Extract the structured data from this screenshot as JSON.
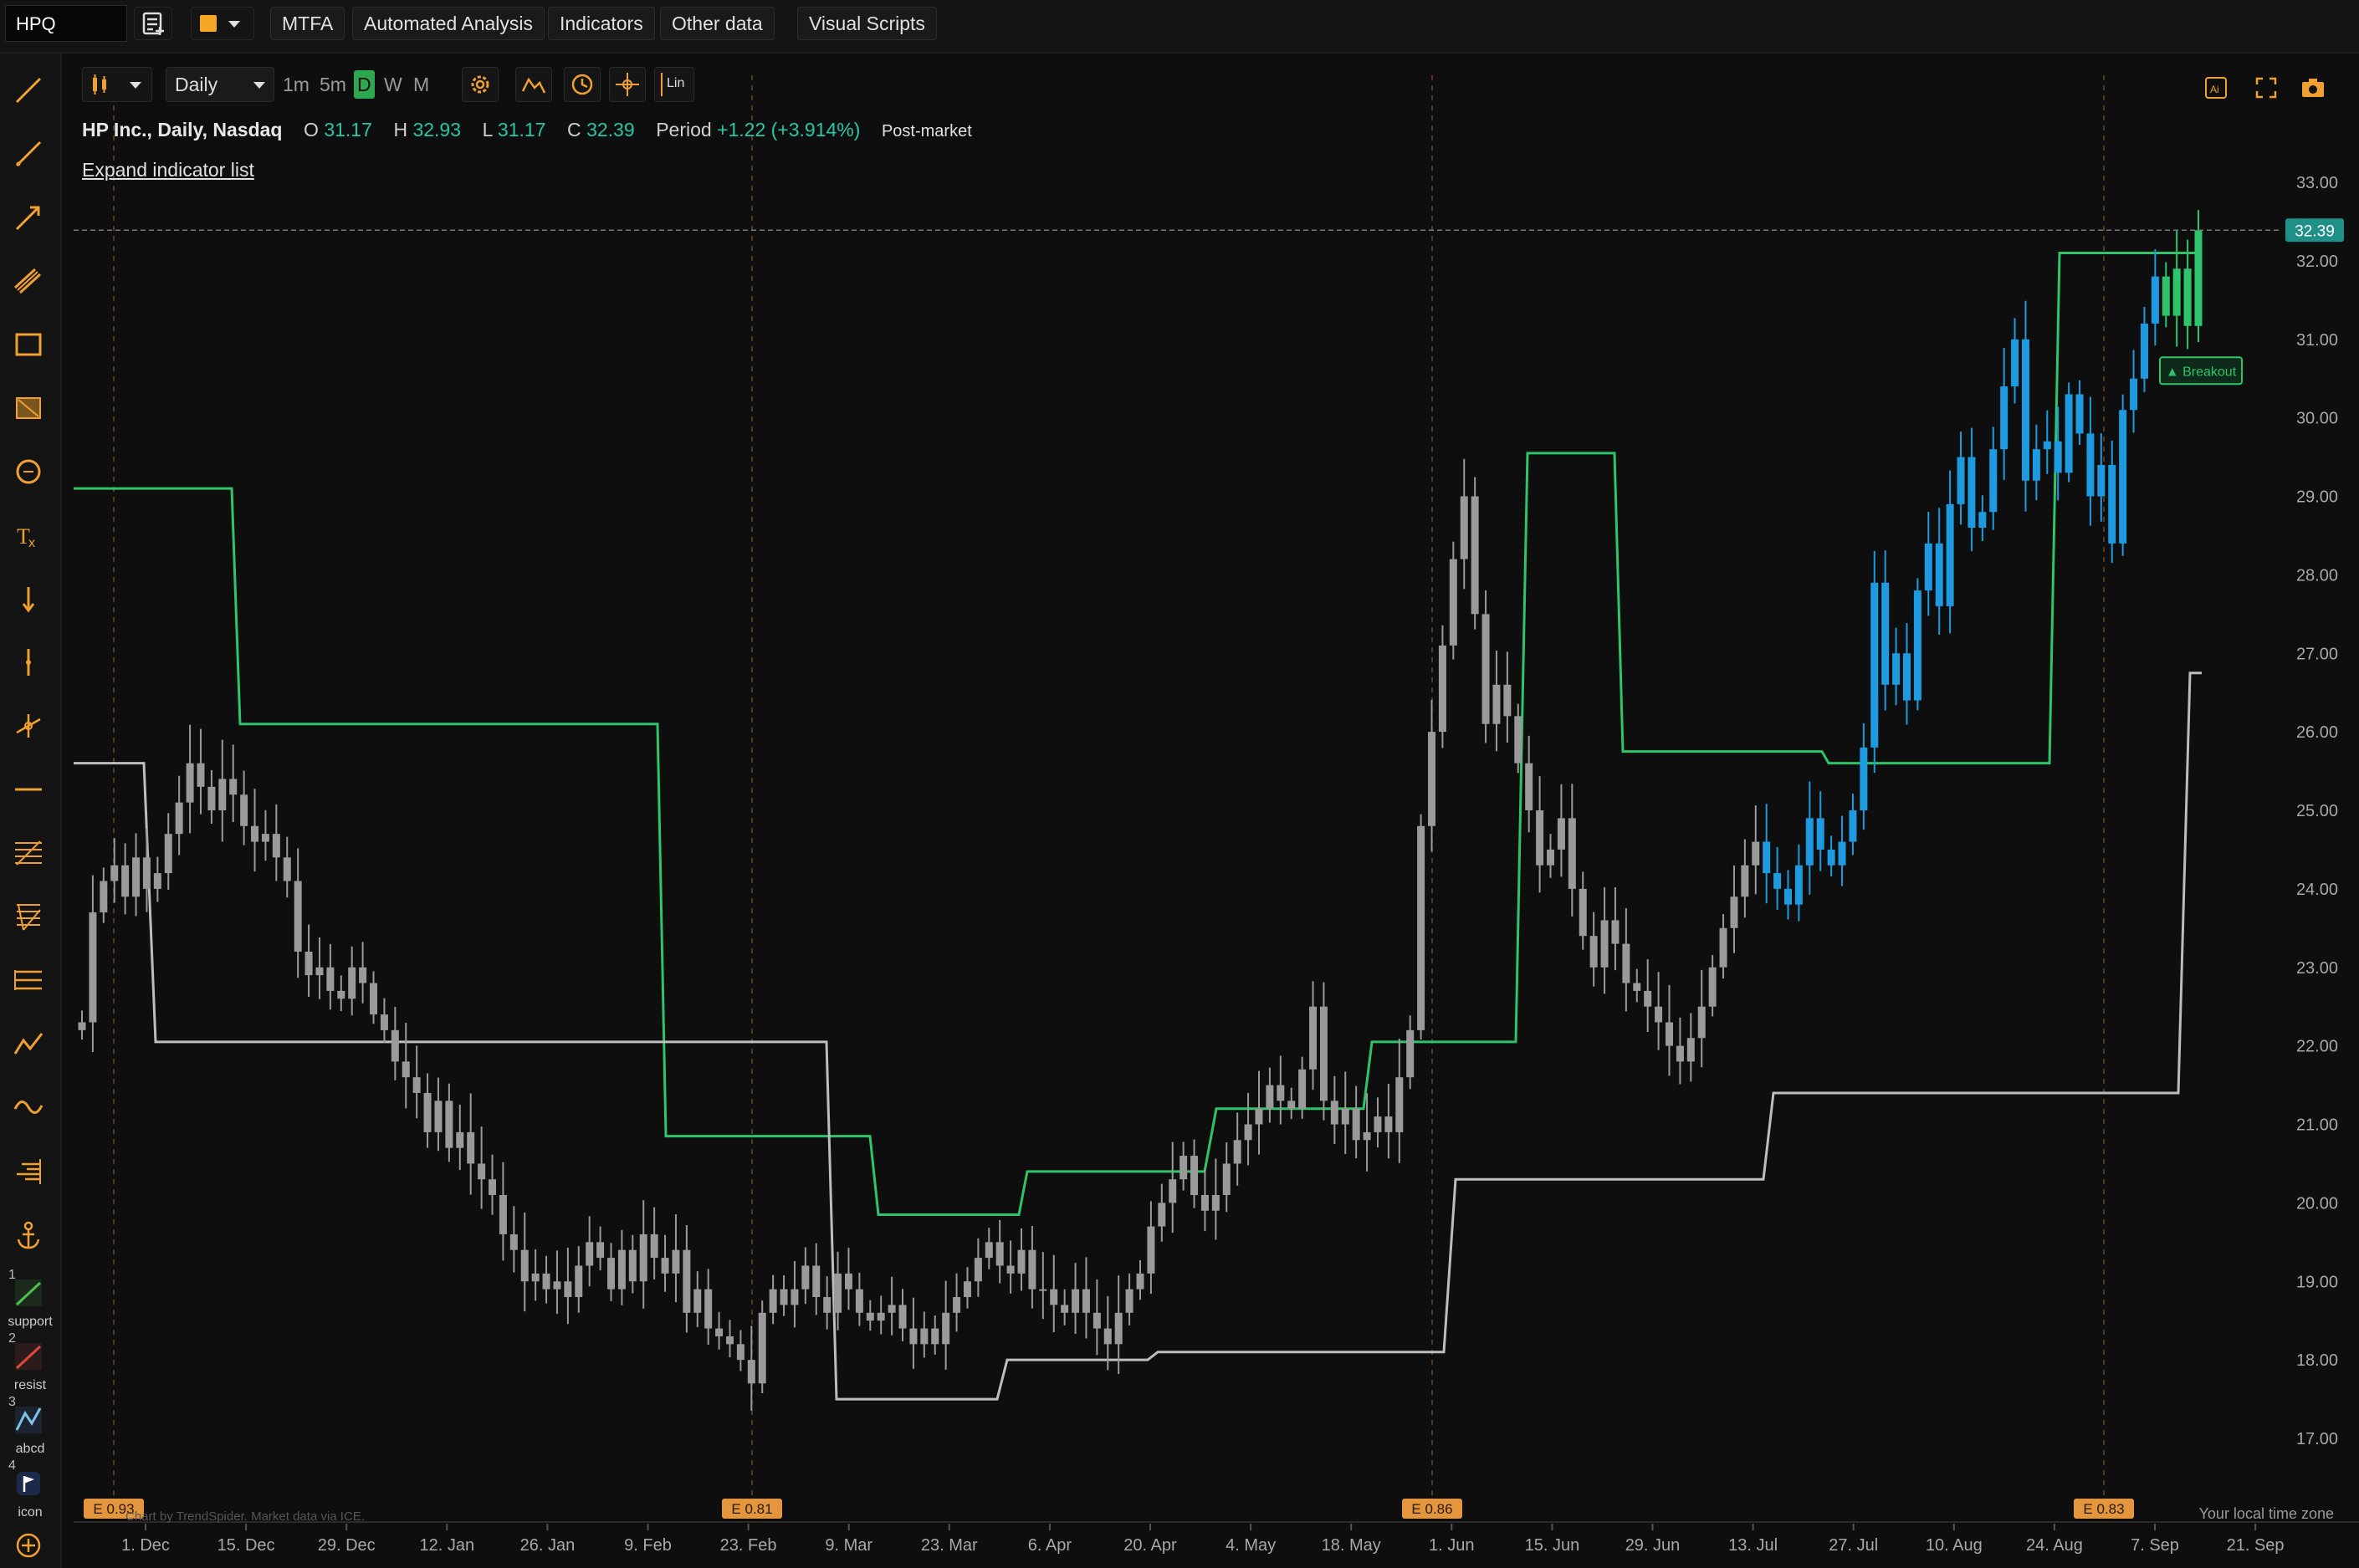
{
  "topbar": {
    "symbol": "HPQ",
    "menus": [
      "MTFA",
      "Automated Analysis",
      "Indicators",
      "Other data",
      "Visual Scripts"
    ]
  },
  "chart_toolbar": {
    "timeframe": "Daily",
    "options": [
      "1m",
      "5m",
      "D",
      "W",
      "M"
    ],
    "active_option": "D",
    "scale_label": "Lin"
  },
  "legend": {
    "title": "HP Inc., Daily, Nasdaq",
    "o_label": "O",
    "o": "31.17",
    "h_label": "H",
    "h": "32.93",
    "l_label": "L",
    "l": "31.17",
    "c_label": "C",
    "c": "32.39",
    "period_label": "Period",
    "period": "+1.22 (+3.914%)",
    "session": "Post-market",
    "expand": "Expand indicator list"
  },
  "left_tools": {
    "captions": [
      "support",
      "resist",
      "abcd",
      "icon"
    ],
    "numbers": [
      "1",
      "2",
      "3",
      "4"
    ]
  },
  "footer": {
    "attribution": "Chart by TrendSpider. Market data via ICE.",
    "timezone": "Your local time zone"
  },
  "colors": {
    "background": "#0e0e0e",
    "candle_neutral": "#9a9a9a",
    "candle_blue": "#1e9be0",
    "candle_green": "#2ec46a",
    "channel_upper": "#2ec46a",
    "channel_lower": "#bdbdbd",
    "price_label": "#1f8f87",
    "earnings": "#e3963e"
  },
  "chart_data": {
    "type": "candlestick",
    "symbol": "HPQ",
    "y_ticks": [
      "33.00",
      "32.00",
      "31.00",
      "30.00",
      "29.00",
      "28.00",
      "27.00",
      "26.00",
      "25.00",
      "24.00",
      "23.00",
      "22.00",
      "21.00",
      "20.00",
      "19.00",
      "18.00",
      "17.00"
    ],
    "ylim": [
      16.5,
      33.75
    ],
    "x_ticks": [
      "1. Dec",
      "15. Dec",
      "29. Dec",
      "12. Jan",
      "26. Jan",
      "9. Feb",
      "23. Feb",
      "9. Mar",
      "23. Mar",
      "6. Apr",
      "20. Apr",
      "4. May",
      "18. May",
      "1. Jun",
      "15. Jun",
      "29. Jun",
      "13. Jul",
      "27. Jul",
      "10. Aug",
      "24. Aug",
      "7. Sep",
      "21. Sep"
    ],
    "current_price": "32.39",
    "earnings": [
      "E 0.93",
      "E 0.81",
      "E 0.86",
      "E 0.83"
    ],
    "breakout_label": "▲ Breakout",
    "closes": [
      22.3,
      23.7,
      24.1,
      24.3,
      23.9,
      24.4,
      24.0,
      24.2,
      24.7,
      25.1,
      25.6,
      25.3,
      25.0,
      25.4,
      25.2,
      24.8,
      24.6,
      24.7,
      24.4,
      24.1,
      23.2,
      22.9,
      23.0,
      22.7,
      22.6,
      23.0,
      22.8,
      22.4,
      22.2,
      21.8,
      21.6,
      21.4,
      20.9,
      21.3,
      20.7,
      20.9,
      20.5,
      20.3,
      20.1,
      19.6,
      19.4,
      19.0,
      19.1,
      18.9,
      19.0,
      18.8,
      19.2,
      19.5,
      19.3,
      18.9,
      19.4,
      19.0,
      19.6,
      19.3,
      19.1,
      19.4,
      18.6,
      18.9,
      18.4,
      18.3,
      18.2,
      18.0,
      17.7,
      18.6,
      18.9,
      18.7,
      18.9,
      19.2,
      18.8,
      18.6,
      19.1,
      18.9,
      18.6,
      18.5,
      18.6,
      18.7,
      18.4,
      18.2,
      18.4,
      18.2,
      18.6,
      18.8,
      19.0,
      19.3,
      19.5,
      19.2,
      19.1,
      19.4,
      18.9,
      18.9,
      18.7,
      18.6,
      18.9,
      18.6,
      18.4,
      18.2,
      18.6,
      18.9,
      19.1,
      19.7,
      20.0,
      20.3,
      20.6,
      20.1,
      19.9,
      20.1,
      20.5,
      20.8,
      21.0,
      21.2,
      21.5,
      21.3,
      21.2,
      21.7,
      22.5,
      21.3,
      21.0,
      21.2,
      20.8,
      20.9,
      21.1,
      20.9,
      21.6,
      22.2,
      24.8,
      26.0,
      27.1,
      28.2,
      29.0,
      27.5,
      26.1,
      26.6,
      26.2,
      25.6,
      25.0,
      24.3,
      24.5,
      24.9,
      24.0,
      23.4,
      23.0,
      23.6,
      23.3,
      22.8,
      22.7,
      22.5,
      22.3,
      22.0,
      21.8,
      22.1,
      22.5,
      23.0,
      23.5,
      23.9,
      24.3,
      24.6,
      24.2,
      24.0,
      23.8,
      24.3,
      24.9,
      24.5,
      24.3,
      24.6,
      25.0,
      25.8,
      27.9,
      26.6,
      27.0,
      26.4,
      27.8,
      28.4,
      27.6,
      28.9,
      29.5,
      28.6,
      28.8,
      29.6,
      30.4,
      31.0,
      29.2,
      29.6,
      29.7,
      29.3,
      30.3,
      29.8,
      29.0,
      29.4,
      28.4,
      30.1,
      30.5,
      31.2,
      31.8,
      31.3,
      31.9,
      31.17,
      32.39
    ]
  }
}
